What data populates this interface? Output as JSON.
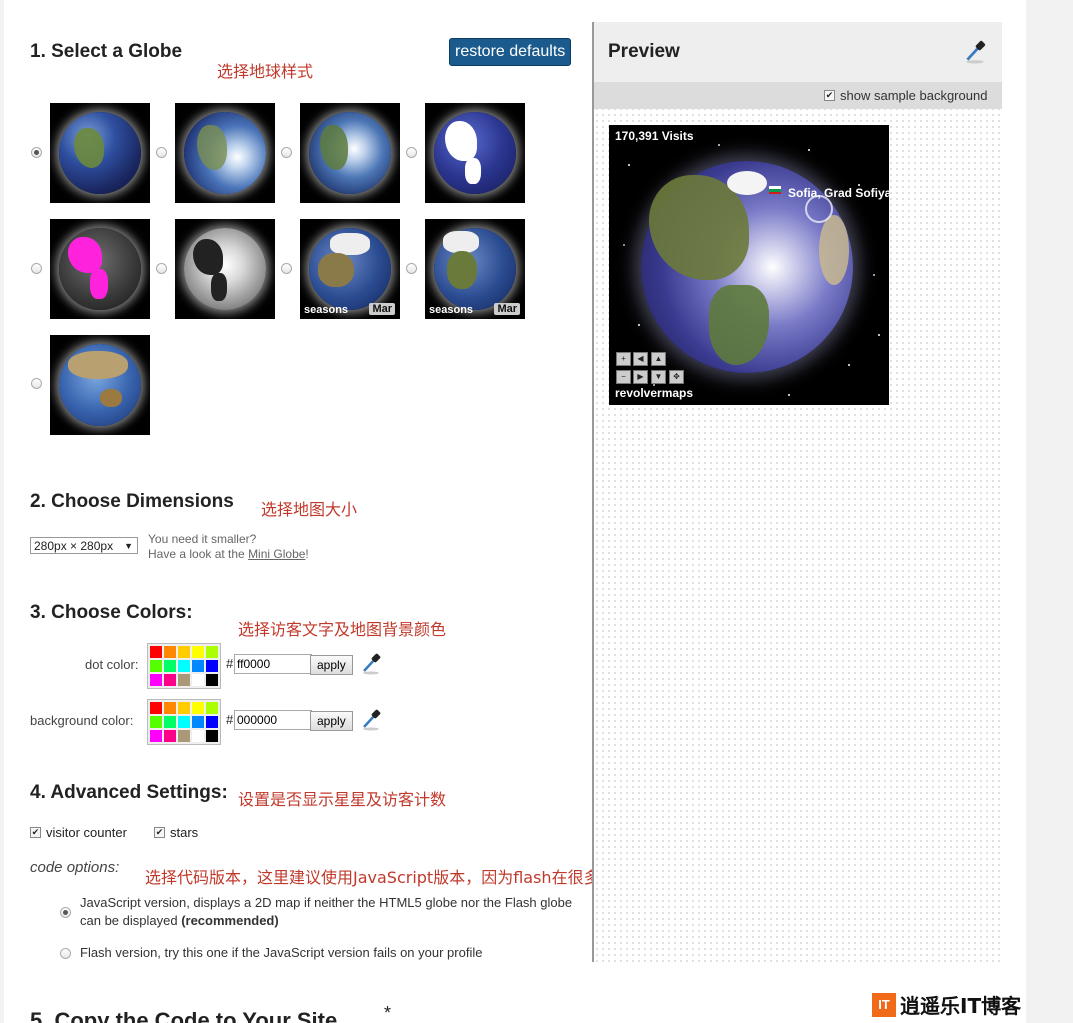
{
  "section1": {
    "title": "1. Select a Globe",
    "annotation": "选择地球样式",
    "restore_label": "restore defaults",
    "globes": [
      {
        "id": "earth-dark",
        "selected": true
      },
      {
        "id": "earth-lit",
        "selected": false
      },
      {
        "id": "earth-bright",
        "selected": false
      },
      {
        "id": "earth-white-land",
        "selected": false
      },
      {
        "id": "magenta",
        "selected": false
      },
      {
        "id": "silver",
        "selected": false
      },
      {
        "id": "seasons-1",
        "selected": false,
        "caption": "seasons",
        "badge": "Mar"
      },
      {
        "id": "seasons-2",
        "selected": false,
        "caption": "seasons",
        "badge": "Mar"
      },
      {
        "id": "earth-asia",
        "selected": false
      }
    ]
  },
  "section2": {
    "title": "2. Choose Dimensions",
    "annotation": "选择地图大小",
    "size_value": "280px × 280px",
    "hint_line1": "You need it smaller?",
    "hint_prefix": "Have a look at the ",
    "hint_link": "Mini Globe",
    "hint_suffix": "!"
  },
  "section3": {
    "title": "3. Choose Colors:",
    "annotation": "选择访客文字及地图背景颜色",
    "dot_label": "dot color:",
    "dot_value": "ff0000",
    "bg_label": "background color:",
    "bg_value": "000000",
    "hash": "#",
    "apply_label": "apply",
    "palette": [
      "#ff0000",
      "#ff8800",
      "#ffcc00",
      "#ffff00",
      "#aaff00",
      "#55ff00",
      "#00ff66",
      "#00ffff",
      "#0088ff",
      "#0000ff",
      "#ff00ff",
      "#ff0088",
      "#aa9977",
      "#ffffff",
      "#000000"
    ]
  },
  "section4": {
    "title": "4. Advanced Settings:",
    "annotation": "设置是否显示星星及访客计数",
    "visitor_counter_label": "visitor counter",
    "visitor_counter_checked": true,
    "stars_label": "stars",
    "stars_checked": true,
    "code_options_label": "code options:",
    "code_annotation": "选择代码版本，这里建议使用JavaScript版本，因为flash在很多设备都没法用了",
    "js_option_text": "JavaScript version, displays a 2D map if neither the HTML5 globe nor the Flash globe can be displayed ",
    "js_option_bold": "(recommended)",
    "js_selected": true,
    "flash_option_text": "Flash version, try this one if the JavaScript version fails on your profile",
    "flash_selected": false
  },
  "section5": {
    "title": "5. Copy the Code to Your Site",
    "asterisk": "*"
  },
  "preview": {
    "title": "Preview",
    "show_bg_label": "show sample background",
    "show_bg_checked": true,
    "visits": "170,391 Visits",
    "city": "Sofia, Grad Sofiya",
    "brand": "revolvermaps"
  },
  "watermark": {
    "logo_letters": "IT",
    "text": "逍遥乐IT博客"
  }
}
